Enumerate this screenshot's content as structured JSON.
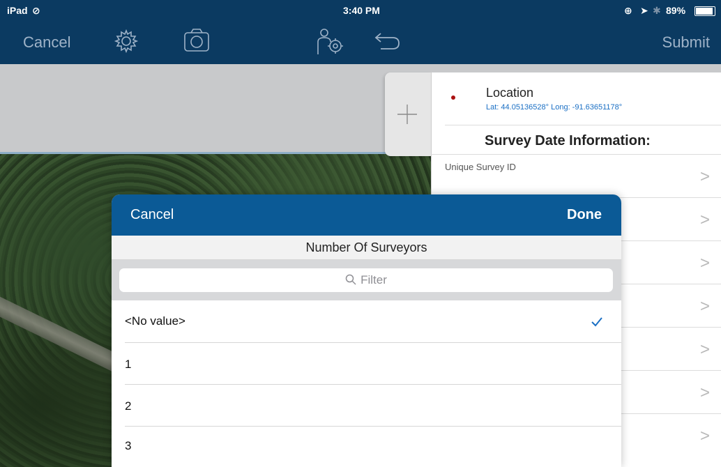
{
  "status_bar": {
    "device": "iPad",
    "time": "3:40 PM",
    "battery": "89%"
  },
  "nav": {
    "cancel": "Cancel",
    "submit": "Submit"
  },
  "form": {
    "location_title": "Location",
    "location_coords": "Lat: 44.05136528° Long: -91.63651178°",
    "section_heading": "Survey Date Information:",
    "field_unique_survey_id": "Unique Survey ID",
    "chevron": ">"
  },
  "modal": {
    "cancel": "Cancel",
    "done": "Done",
    "title": "Number Of Surveyors",
    "filter_placeholder": "Filter",
    "options": [
      "<No value>",
      "1",
      "2",
      "3"
    ],
    "selected_index": 0
  },
  "colors": {
    "nav_bg": "#0b3a61",
    "modal_header": "#0b5a96",
    "checkmark": "#1a6fc4"
  }
}
